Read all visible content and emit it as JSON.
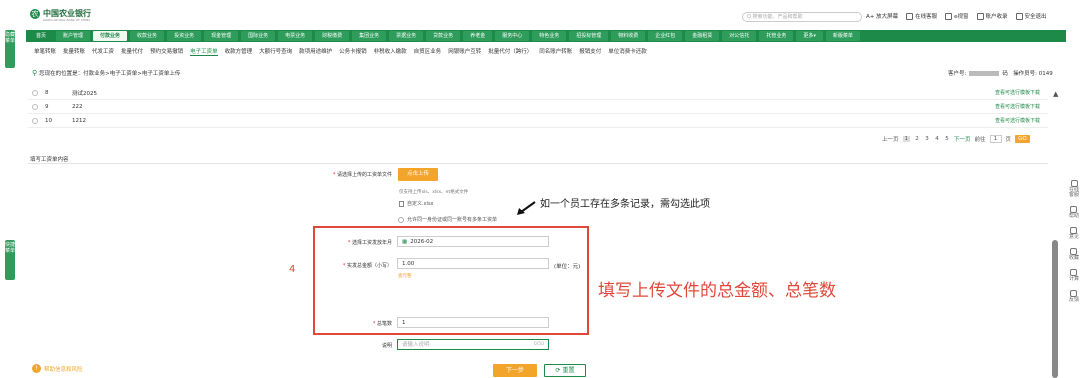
{
  "header": {
    "bank_name": "中国农业银行",
    "bank_sub": "AGRICULTURAL BANK OF CHINA",
    "search_placeholder": "Q 搜索功能、产品和帮助",
    "tools": [
      "A+ 放大屏幕",
      "在线客服",
      "e视窗",
      "账户收录",
      "安全退出"
    ]
  },
  "nav": {
    "items": [
      "首页",
      "账户管理",
      "付款业务",
      "收款业务",
      "投资业务",
      "现金管理",
      "国际业务",
      "电票业务",
      "财税缴费",
      "集团业务",
      "票据业务",
      "贷款业务",
      "养老金",
      "服务中心",
      "特色业务",
      "招投标管理",
      "物料收费",
      "企业红包",
      "金融租赁",
      "对公信托",
      "托管业务",
      "更多▾",
      "新版菜单"
    ],
    "active_index": 2
  },
  "subnav": {
    "items": [
      "单笔转账",
      "批量转账",
      "代发工资",
      "批量代付",
      "预约交易撤销",
      "电子工资单",
      "收款方管理",
      "大额行号查询",
      "款项用途维护",
      "公务卡报销",
      "非税收入缴款",
      "自贸区业务",
      "网银账户互转",
      "批量代付（跨行）",
      "同名账户转账",
      "报销支付",
      "单位消费卡还款"
    ],
    "active_index": 5
  },
  "breadcrumb": {
    "text": "您现在的位置是：付款业务>电子工资单>电子工资单上传",
    "customer_label": "客户号:",
    "customer_suffix": "码",
    "operator_label": "操作员号:",
    "operator_id": "0149"
  },
  "table": {
    "rows": [
      {
        "num": "8",
        "name": "测试2025",
        "link": "查看可选行模板下载"
      },
      {
        "num": "9",
        "name": "222",
        "link": "查看可选行模板下载"
      },
      {
        "num": "10",
        "name": "1212",
        "link": "查看可选行模板下载"
      }
    ]
  },
  "pager": {
    "prev": "上一页",
    "pages": [
      "1",
      "2",
      "3",
      "4",
      "5"
    ],
    "current": "1",
    "next": "下一页",
    "goto_label": "前往",
    "goto_value": "1",
    "page_unit": "页",
    "go": "GO"
  },
  "form": {
    "section_title": "填写工资单内容",
    "upload_label": "请选择上传的工资单文件",
    "upload_button": "点击上传",
    "upload_hint": "仅支持上传xls、xlsx、et格式文件",
    "file_name": "自定义.xlsx",
    "allow_duplicate": "允许同一身份证或同一账号有多条工资单",
    "month_label": "选择工资发放年月",
    "month_value": "2026-02",
    "amount_label": "实发总金额（小写）",
    "amount_value": "1.00",
    "amount_unit": "(单位：元)",
    "amount_capital": "壹元整",
    "count_label": "总笔数",
    "count_value": "1",
    "desc_label": "说明",
    "desc_placeholder": "请输入说明",
    "desc_counter": "0/50",
    "next_button": "下一步",
    "reset_button": "重置"
  },
  "annotations": {
    "multi_record": "如一个员工存在多条记录，需勾选此项",
    "step_number": "4",
    "fill_hint": "填写上传文件的总金额、总笔数"
  },
  "bottom": {
    "icon": "!",
    "text": "帮助信息和风险"
  },
  "side": {
    "left_top": "隐藏菜单",
    "left_mid": "快捷菜单"
  },
  "right_panel": [
    "在线客服",
    "帮助",
    "意见",
    "收藏",
    "计算",
    "反馈"
  ]
}
